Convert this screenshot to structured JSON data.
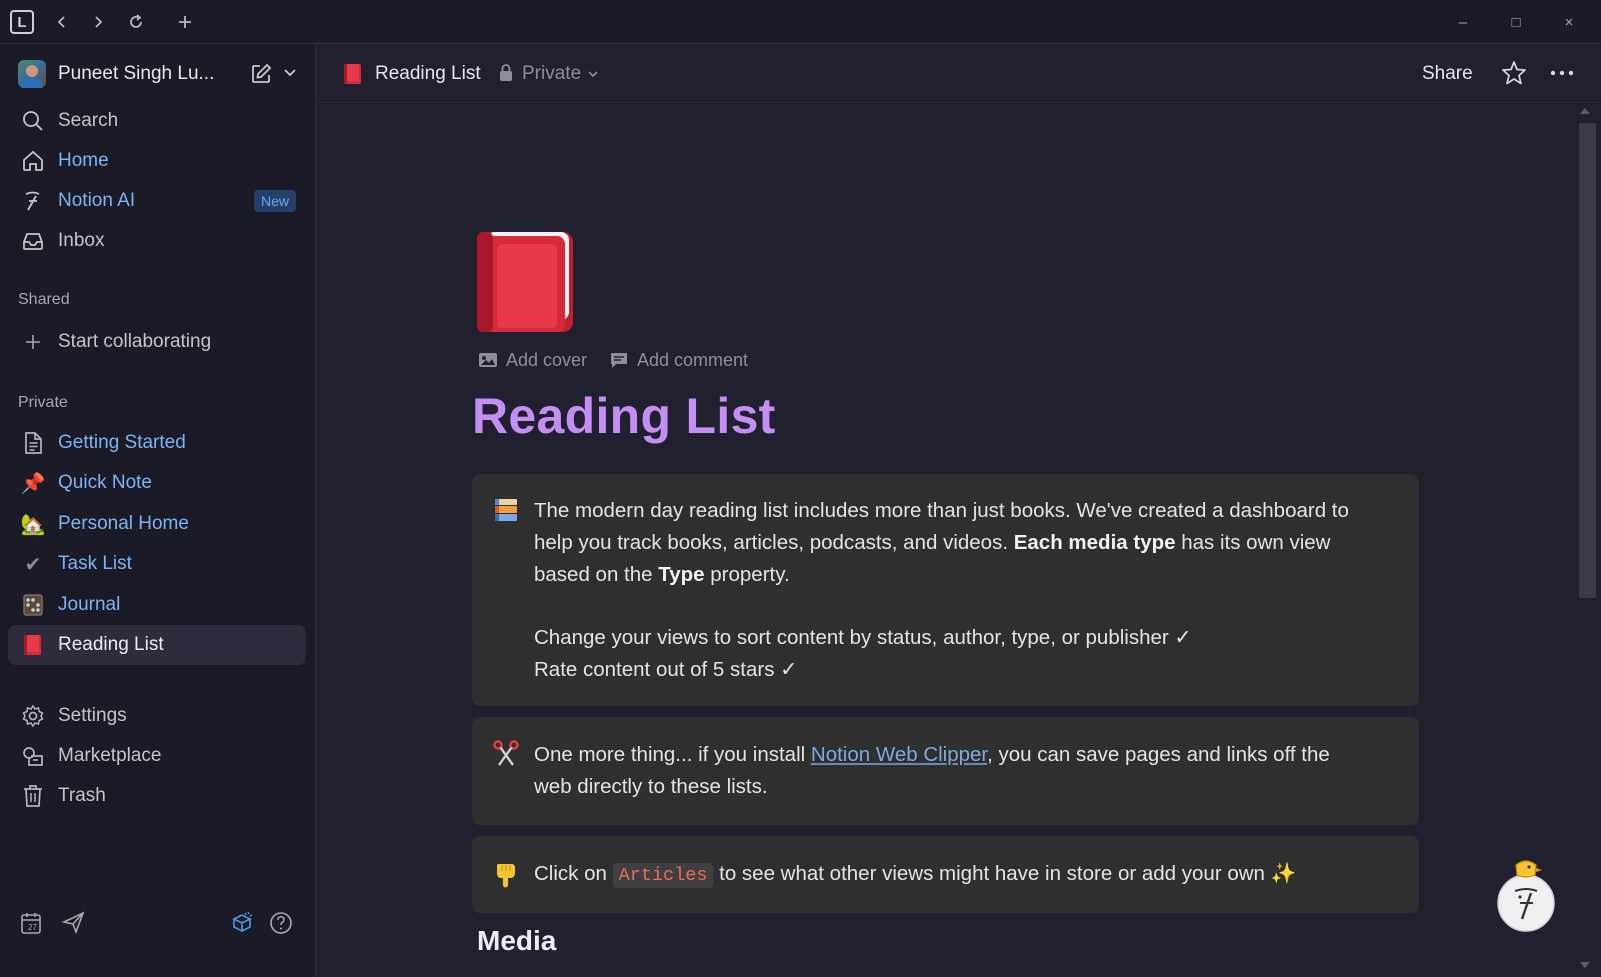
{
  "titlebar": {
    "app_logo_text": "L",
    "back_icon": "chevron-left-icon",
    "forward_icon": "chevron-right-icon",
    "reload_icon": "reload-icon",
    "new_tab_icon": "plus-icon",
    "minimize": "–",
    "maximize": "□",
    "close": "×"
  },
  "sidebar": {
    "workspace_name": "Puneet Singh Lu...",
    "top_items": [
      {
        "label": "Search",
        "icon": "search-icon"
      },
      {
        "label": "Home",
        "icon": "home-icon"
      },
      {
        "label": "Notion AI",
        "icon": "notion-ai-icon",
        "badge": "New"
      },
      {
        "label": "Inbox",
        "icon": "inbox-icon"
      }
    ],
    "shared_label": "Shared",
    "shared_items": [
      {
        "label": "Start collaborating",
        "icon": "plus-icon"
      }
    ],
    "private_label": "Private",
    "private_items": [
      {
        "label": "Getting Started",
        "icon": "document-icon",
        "glyph": ""
      },
      {
        "label": "Quick Note",
        "icon": "pushpin-icon",
        "glyph": "📌"
      },
      {
        "label": "Personal Home",
        "icon": "house-garden-icon",
        "glyph": "🏡"
      },
      {
        "label": "Task List",
        "icon": "checkmark-icon",
        "glyph": "✔"
      },
      {
        "label": "Journal",
        "icon": "abacus-icon",
        "glyph": "▩"
      },
      {
        "label": "Reading List",
        "icon": "red-book-icon",
        "glyph": ""
      }
    ],
    "bottom_items": [
      {
        "label": "Settings",
        "icon": "gear-icon"
      },
      {
        "label": "Marketplace",
        "icon": "marketplace-icon"
      },
      {
        "label": "Trash",
        "icon": "trash-icon"
      }
    ],
    "footer_icons": [
      "calendar-icon",
      "send-icon",
      "templates-icon",
      "help-icon"
    ]
  },
  "pagebar": {
    "title": "Reading List",
    "privacy": "Private",
    "share_label": "Share"
  },
  "page": {
    "add_cover": "Add cover",
    "add_comment": "Add comment",
    "title": "Reading List",
    "callout1": {
      "icon": "books-icon",
      "p1_a": "The modern day reading list includes more than just books. We've created a dashboard to help you track books, articles, podcasts, and videos. ",
      "p1_bold1": "Each media type",
      "p1_b": " has its own view based on the ",
      "p1_bold2": "Type",
      "p1_c": " property.",
      "line2": "Change your views to sort content by status, author, type, or publisher ✓",
      "line3": "Rate content out of 5 stars ✓"
    },
    "callout2": {
      "icon": "scissors-icon",
      "text_a": "One more thing... if you install ",
      "link": "Notion Web Clipper",
      "text_b": ", you can save pages and links off the web directly to these lists."
    },
    "callout3": {
      "icon": "pointing-down-icon",
      "text_a": "Click on ",
      "code": "Articles",
      "text_b": " to see what other views might have in store or add your own ✨"
    },
    "media_heading": "Media"
  },
  "colors": {
    "title_purple": "#c48ef5",
    "link_blue": "#7eb2f2",
    "callout_bg": "#2f2f2f",
    "code_red": "#eb6a5e"
  }
}
